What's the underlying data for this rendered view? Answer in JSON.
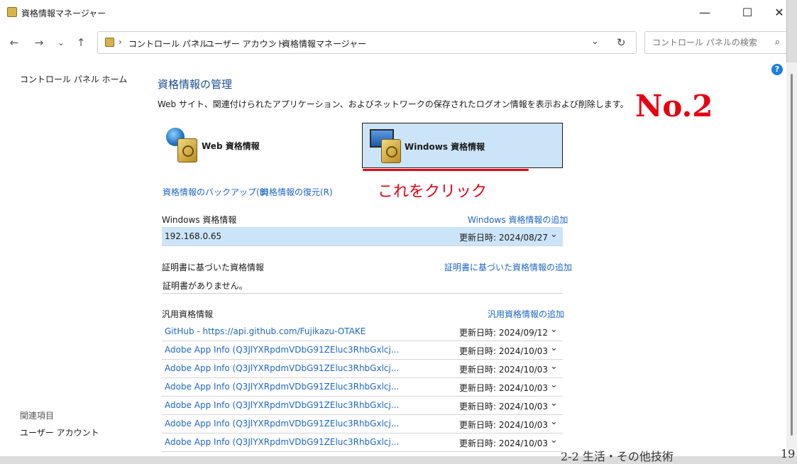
{
  "window": {
    "title": "資格情報マネージャー"
  },
  "window_controls": {
    "minimize": "—",
    "maximize": "☐",
    "close": "✕"
  },
  "address": {
    "crumbs": [
      "コントロール パネル",
      "ユーザー アカウント",
      "資格情報マネージャー"
    ],
    "separator": "›",
    "search_placeholder": "コントロール パネルの検索"
  },
  "nav": {
    "back": "←",
    "forward": "→",
    "recent": "⌄",
    "up": "↑",
    "dropdown": "⌄",
    "refresh": "↻",
    "search_icon": "⌕"
  },
  "left_nav": {
    "home": "コントロール パネル ホーム",
    "related_heading": "関連項目",
    "user_accounts": "ユーザー アカウント"
  },
  "main": {
    "heading": "資格情報の管理",
    "description": "Web サイト、関連付けられたアプリケーション、およびネットワークの保存されたログオン情報を表示および削除します。",
    "tiles": {
      "web": "Web 資格情報",
      "windows": "Windows 資格情報"
    },
    "backup_link": "資格情報のバックアップ(B)",
    "restore_link": "資格情報の復元(R)",
    "windows_section": {
      "title": "Windows 資格情報",
      "add": "Windows 資格情報の追加",
      "items": [
        {
          "name": "192.168.0.65",
          "date": "更新日時:  2024/08/27"
        }
      ]
    },
    "cert_section": {
      "title": "証明書に基づいた資格情報",
      "add": "証明書に基づいた資格情報の追加",
      "empty": "証明書がありません。"
    },
    "generic_section": {
      "title": "汎用資格情報",
      "add": "汎用資格情報の追加",
      "items": [
        {
          "name": "GitHub - https://api.github.com/Fujikazu-OTAKE",
          "date": "更新日時:  2024/09/12"
        },
        {
          "name": "Adobe App Info (Q3JlYXRpdmVDbG91ZEluc3RhbGxlcj...",
          "date": "更新日時:  2024/10/03"
        },
        {
          "name": "Adobe App Info (Q3JlYXRpdmVDbG91ZEluc3RhbGxlcj...",
          "date": "更新日時:  2024/10/03"
        },
        {
          "name": "Adobe App Info (Q3JlYXRpdmVDbG91ZEluc3RhbGxlcj...",
          "date": "更新日時:  2024/10/03"
        },
        {
          "name": "Adobe App Info (Q3JlYXRpdmVDbG91ZEluc3RhbGxlcj...",
          "date": "更新日時:  2024/10/03"
        },
        {
          "name": "Adobe App Info (Q3JlYXRpdmVDbG91ZEluc3RhbGxlcj...",
          "date": "更新日時:  2024/10/03"
        },
        {
          "name": "Adobe App Info (Q3JlYXRpdmVDbG91ZEluc3RhbGxlcj...",
          "date": "更新日時:  2024/10/03"
        }
      ]
    },
    "chevron": "⌄",
    "help": "?"
  },
  "annotations": {
    "number": "No.2",
    "click_note": "これをクリック"
  },
  "background": {
    "bottom_right_text": "2-2 生活・その他技術",
    "page_num": "19"
  }
}
